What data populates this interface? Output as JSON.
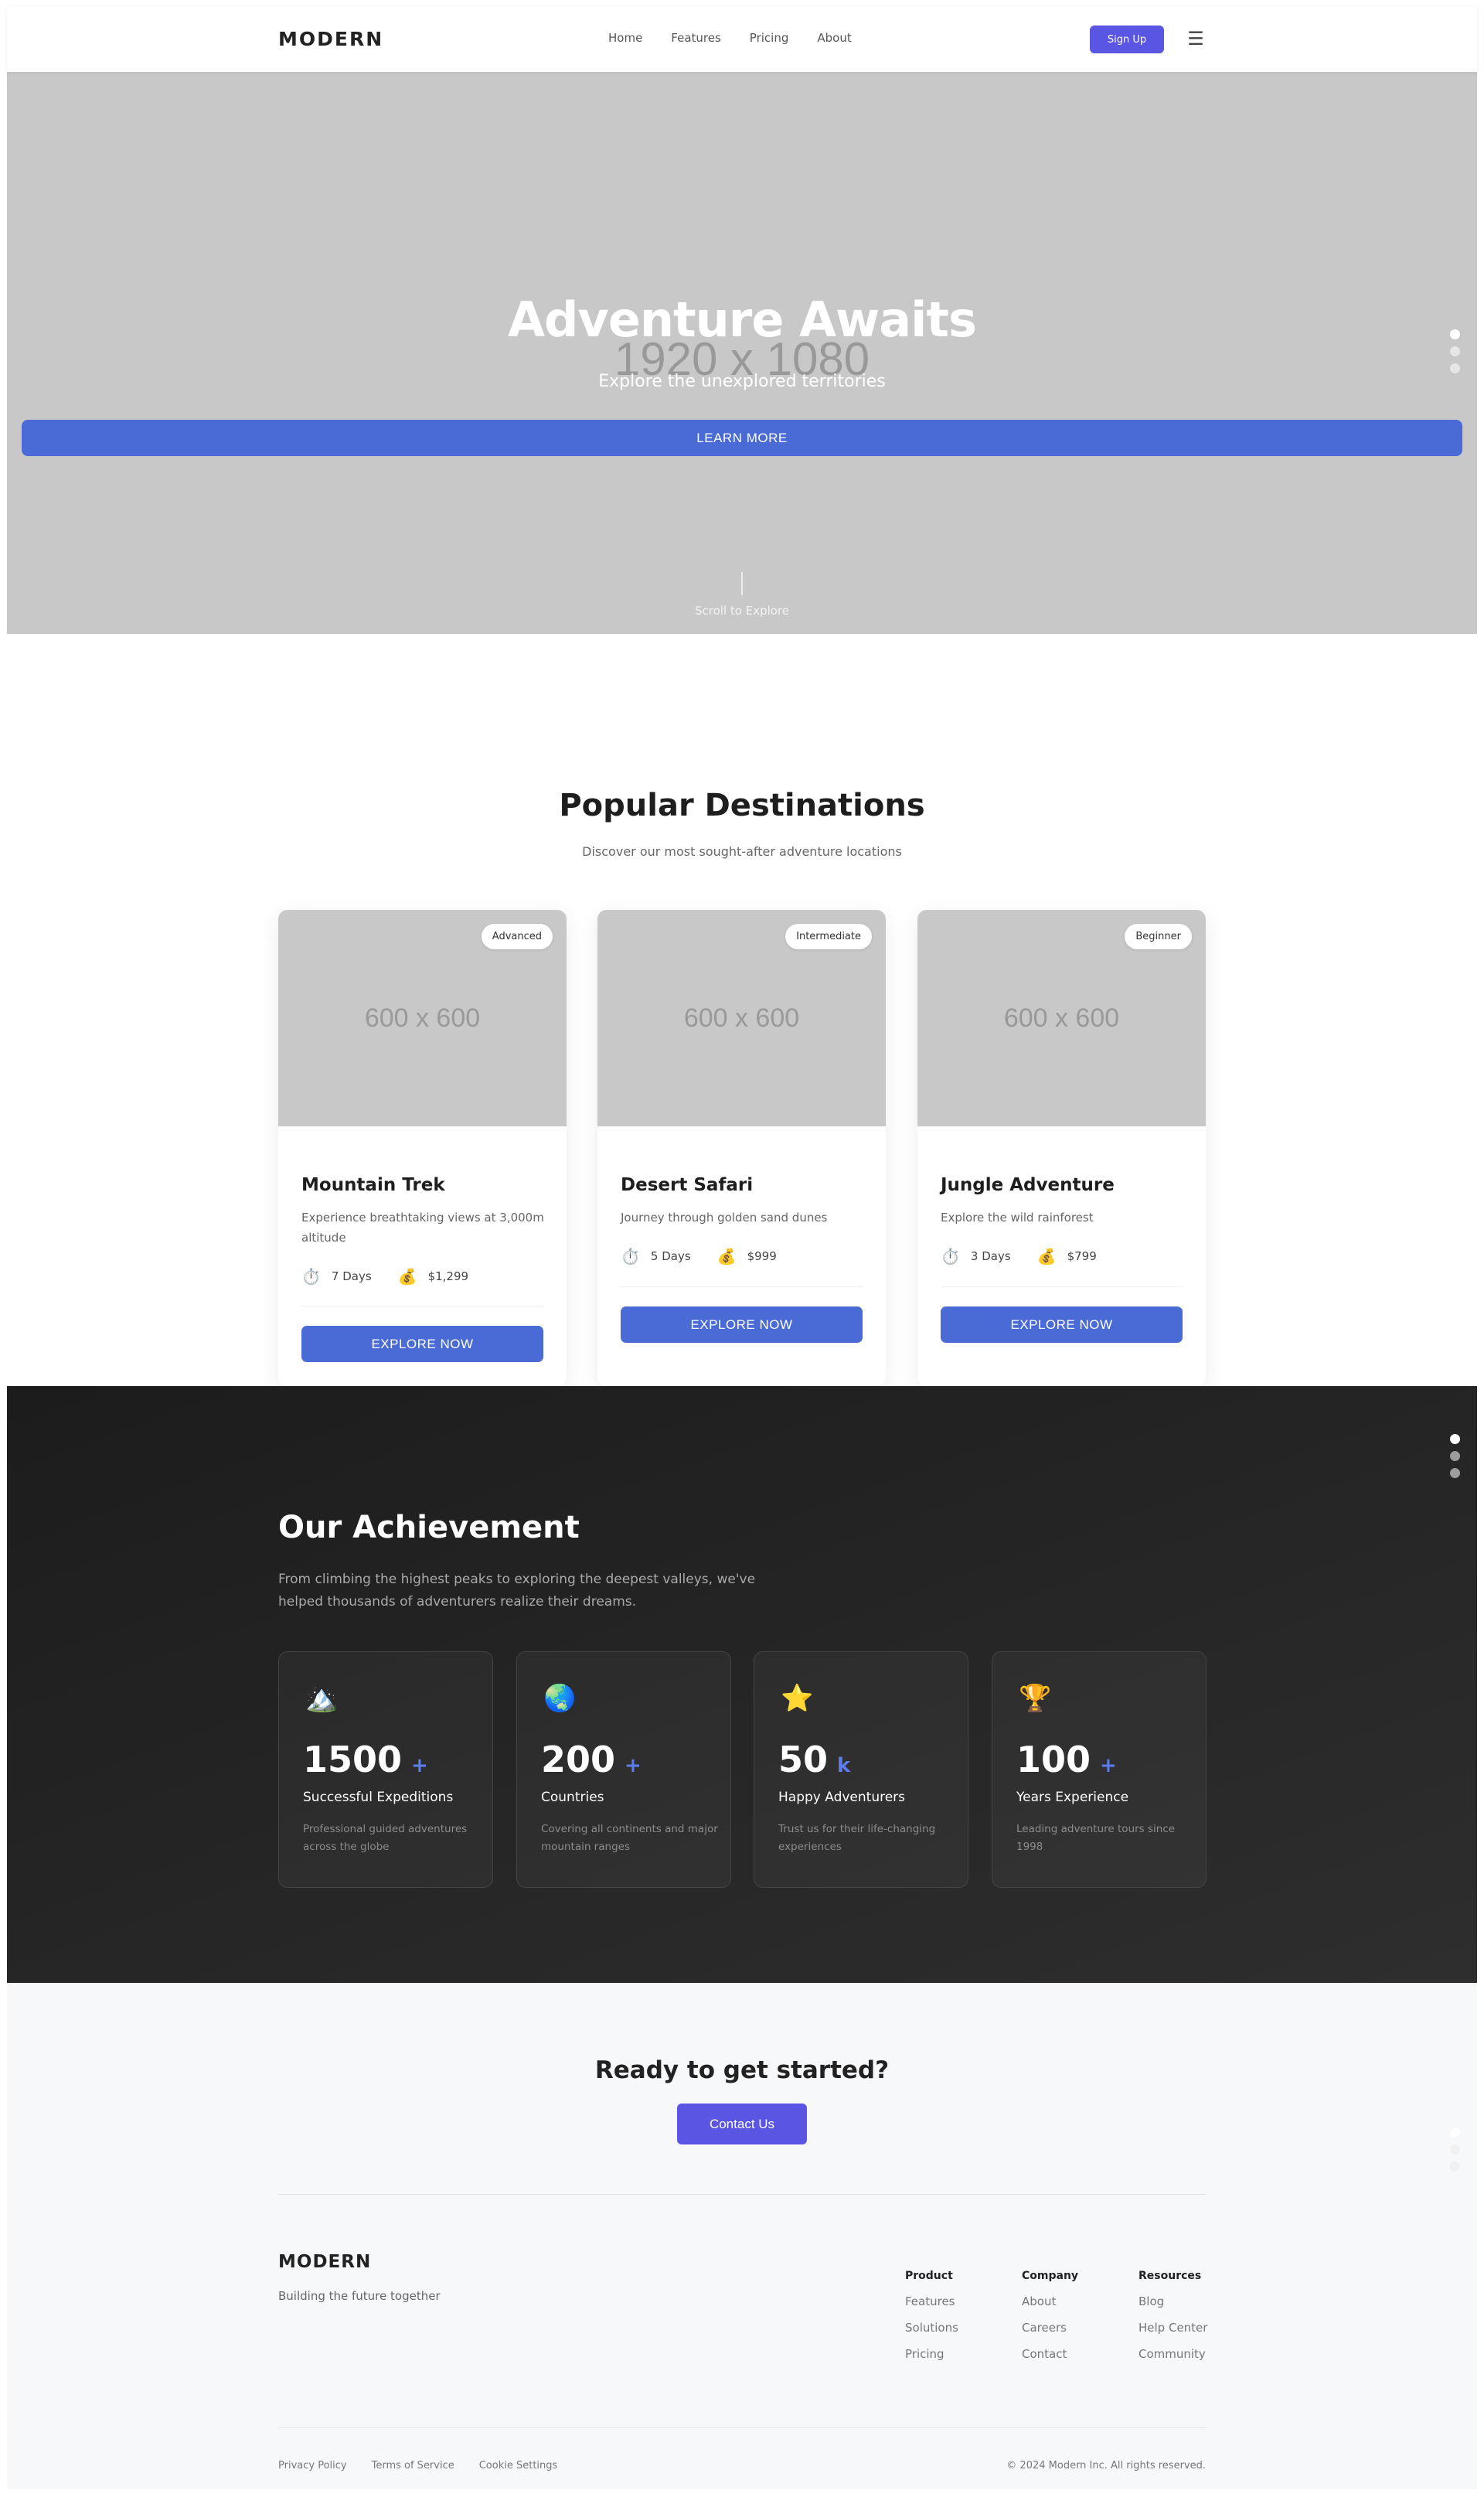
{
  "nav": {
    "logo": "MODERN",
    "links": [
      "Home",
      "Features",
      "Pricing",
      "About"
    ],
    "signup_label": "Sign Up",
    "menu_icon": "☰"
  },
  "hero": {
    "placeholder": "1920 x 1080",
    "title": "Adventure Awaits",
    "subtitle": "Explore the unexplored territories",
    "cta_label": "LEARN MORE",
    "scroll_label": "Scroll to Explore"
  },
  "destinations": {
    "title": "Popular Destinations",
    "subtitle": "Discover our most sought-after adventure locations",
    "cards": [
      {
        "placeholder": "600 x 600",
        "badge": "Advanced",
        "title": "Mountain Trek",
        "description": "Experience breathtaking views at 3,000m altitude",
        "duration_icon": "⏱️",
        "duration": "7 Days",
        "price_icon": "💰",
        "price": "$1,299",
        "button": "EXPLORE NOW"
      },
      {
        "placeholder": "600 x 600",
        "badge": "Intermediate",
        "title": "Desert Safari",
        "description": "Journey through golden sand dunes",
        "duration_icon": "⏱️",
        "duration": "5 Days",
        "price_icon": "💰",
        "price": "$999",
        "button": "EXPLORE NOW"
      },
      {
        "placeholder": "600 x 600",
        "badge": "Beginner",
        "title": "Jungle Adventure",
        "description": "Explore the wild rainforest",
        "duration_icon": "⏱️",
        "duration": "3 Days",
        "price_icon": "💰",
        "price": "$799",
        "button": "EXPLORE NOW"
      }
    ]
  },
  "achievement": {
    "title": "Our Achievement",
    "text": "From climbing the highest peaks to exploring the deepest valleys, we've helped thousands of adventurers realize their dreams.",
    "stats": [
      {
        "icon": "🏔️",
        "value": "1500",
        "suffix": "+",
        "label": "Successful Expeditions",
        "detail": "Professional guided adventures across the globe"
      },
      {
        "icon": "🌏",
        "value": "200",
        "suffix": "+",
        "label": "Countries",
        "detail": "Covering all continents and major mountain ranges"
      },
      {
        "icon": "⭐",
        "value": "50",
        "suffix": "k",
        "label": "Happy Adventurers",
        "detail": "Trust us for their life-changing experiences"
      },
      {
        "icon": "🏆",
        "value": "100",
        "suffix": "+",
        "label": "Years Experience",
        "detail": "Leading adventure tours since 1998"
      }
    ]
  },
  "cta": {
    "title": "Ready to get started?",
    "button": "Contact Us"
  },
  "footer": {
    "logo": "MODERN",
    "tagline": "Building the future together",
    "columns": [
      {
        "heading": "Product",
        "links": [
          "Features",
          "Solutions",
          "Pricing"
        ]
      },
      {
        "heading": "Company",
        "links": [
          "About",
          "Careers",
          "Contact"
        ]
      },
      {
        "heading": "Resources",
        "links": [
          "Blog",
          "Help Center",
          "Community"
        ]
      }
    ],
    "legal": [
      "Privacy Policy",
      "Terms of Service",
      "Cookie Settings"
    ],
    "copyright": "© 2024 Modern Inc. All rights reserved."
  },
  "colors": {
    "accent": "#4a6bd6",
    "brand": "#5b55e3",
    "dark_section": "#222222",
    "placeholder": "#c8c8c8"
  }
}
